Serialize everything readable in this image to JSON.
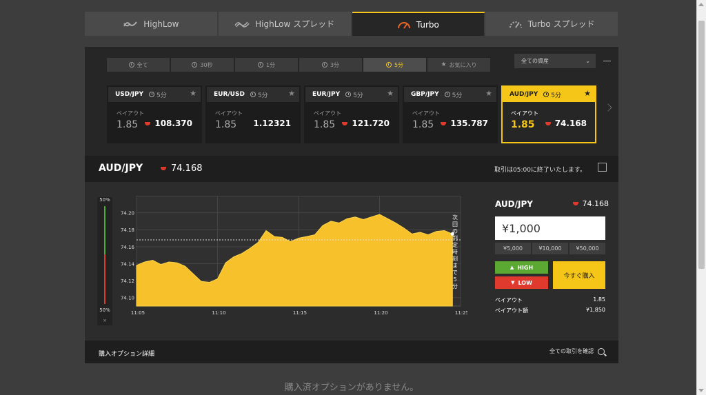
{
  "top_tabs": [
    {
      "label": "HighLow",
      "icon": "highlow-icon",
      "active": false
    },
    {
      "label": "HighLow スプレッド",
      "icon": "highlow-spread-icon",
      "active": false
    },
    {
      "label": "Turbo",
      "icon": "speedometer-icon",
      "active": true
    },
    {
      "label": "Turbo スプレッド",
      "icon": "speedometer-dashed-icon",
      "active": false
    }
  ],
  "sub_tabs": [
    {
      "label": "全て",
      "icon": "clock-icon"
    },
    {
      "label": "30秒",
      "icon": "clock-icon"
    },
    {
      "label": "1分",
      "icon": "clock-icon"
    },
    {
      "label": "3分",
      "icon": "clock-icon"
    },
    {
      "label": "5分",
      "icon": "clock-icon",
      "active": true
    },
    {
      "label": "お気に入り",
      "icon": "star-icon"
    }
  ],
  "asset_filter": {
    "selected": "全ての資産"
  },
  "cards": [
    {
      "pair": "USD/JPY",
      "duration": "5分",
      "payout_label": "ペイアウト",
      "payout": "1.85",
      "price": "108.370"
    },
    {
      "pair": "EUR/USD",
      "duration": "5分",
      "payout_label": "ペイアウト",
      "payout": "1.85",
      "price": "1.12321"
    },
    {
      "pair": "EUR/JPY",
      "duration": "5分",
      "payout_label": "ペイアウト",
      "payout": "1.85",
      "price": "121.720"
    },
    {
      "pair": "GBP/JPY",
      "duration": "5分",
      "payout_label": "ペイアウト",
      "payout": "1.85",
      "price": "135.787"
    },
    {
      "pair": "AUD/JPY",
      "duration": "5分",
      "payout_label": "ペイアウト",
      "payout": "1.85",
      "price": "74.168",
      "active": true
    }
  ],
  "selected": {
    "pair": "AUD/JPY",
    "price": "74.168",
    "message": "取引は05:00に終了いたします。"
  },
  "sentiment": {
    "top": "50%",
    "bottom": "50%",
    "close": "×",
    "high_fraction": 0.5
  },
  "chart_data": {
    "type": "area",
    "y_ticks": [
      "74.10",
      "74.12",
      "74.14",
      "74.16",
      "74.18",
      "74.20"
    ],
    "x_ticks": [
      "11:05",
      "11:10",
      "11:15",
      "11:20",
      "11:25"
    ],
    "ylim": [
      74.09,
      74.22
    ],
    "xlim": [
      0,
      20
    ],
    "current_price": 74.168,
    "annotation": "次回の判定時刻まで5分",
    "x": [
      0,
      0.5,
      1,
      1.5,
      2,
      2.5,
      3,
      3.5,
      4,
      4.5,
      5,
      5.5,
      6,
      6.5,
      7,
      7.5,
      8,
      8.5,
      9,
      9.5,
      10,
      10.5,
      11,
      11.5,
      12,
      12.5,
      13,
      13.5,
      14,
      14.5,
      15,
      15.5,
      16,
      16.5,
      17,
      17.5,
      18,
      18.5,
      19,
      19.5
    ],
    "y": [
      74.138,
      74.142,
      74.144,
      74.139,
      74.142,
      74.141,
      74.137,
      74.128,
      74.119,
      74.118,
      74.122,
      74.141,
      74.148,
      74.152,
      74.158,
      74.165,
      74.179,
      74.172,
      74.171,
      74.166,
      74.17,
      74.172,
      74.174,
      74.185,
      74.19,
      74.188,
      74.193,
      74.195,
      74.192,
      74.195,
      74.198,
      74.193,
      74.188,
      74.182,
      74.175,
      74.177,
      74.174,
      74.178,
      74.179,
      74.175
    ]
  },
  "order": {
    "pair": "AUD/JPY",
    "price": "74.168",
    "amount": "¥1,000",
    "presets": [
      "¥5,000",
      "¥10,000",
      "¥50,000"
    ],
    "high_label": "HIGH",
    "low_label": "LOW",
    "buy_label": "今すぐ購入",
    "payout_label": "ペイアウト",
    "payout_value": "1.85",
    "payout_amount_label": "ペイアウト額",
    "payout_amount_value": "¥1,850"
  },
  "options": {
    "title": "購入オプション詳細",
    "link": "全ての取引を確認",
    "empty": "購入済オプションがありません。"
  },
  "colors": {
    "accent": "#f5c518",
    "high": "#5ba833",
    "low": "#e03a2f"
  }
}
